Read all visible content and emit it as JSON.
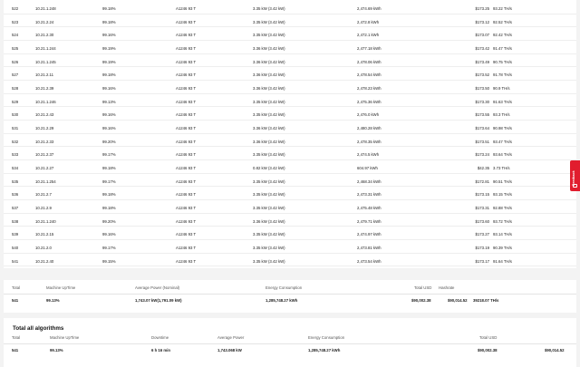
{
  "rows": [
    {
      "id": "522",
      "ip": "10.21.1.248",
      "uptime": "99.18%",
      "model": "A1246 93 T",
      "power": "3.35 kW (3.42 kW)",
      "energy": "2,474.69 kWh",
      "usd": "$173.25",
      "hash": "93.22 TH/s"
    },
    {
      "id": "523",
      "ip": "10.21.2.24",
      "uptime": "99.18%",
      "model": "A1246 93 T",
      "power": "3.35 kW (3.42 kW)",
      "energy": "2,472.8 kWh",
      "usd": "$173.12",
      "hash": "92.52 TH/s"
    },
    {
      "id": "524",
      "ip": "10.21.2.30",
      "uptime": "99.16%",
      "model": "A1246 93 T",
      "power": "3.35 kW (3.42 kW)",
      "energy": "2,472.1 kWh",
      "usd": "$173.07",
      "hash": "92.42 TH/s"
    },
    {
      "id": "525",
      "ip": "10.21.1.244",
      "uptime": "99.19%",
      "model": "A1246 93 T",
      "power": "3.36 kW (3.42 kW)",
      "energy": "2,477.18 kWh",
      "usd": "$173.42",
      "hash": "91.47 TH/s"
    },
    {
      "id": "526",
      "ip": "10.21.1.245",
      "uptime": "99.19%",
      "model": "A1246 93 T",
      "power": "3.36 kW (3.42 kW)",
      "energy": "2,478.06 kWh",
      "usd": "$173.49",
      "hash": "90.75 TH/s"
    },
    {
      "id": "527",
      "ip": "10.21.2.11",
      "uptime": "99.18%",
      "model": "A1246 93 T",
      "power": "3.36 kW (3.42 kW)",
      "energy": "2,478.54 kWh",
      "usd": "$173.52",
      "hash": "91.78 TH/s"
    },
    {
      "id": "528",
      "ip": "10.21.2.39",
      "uptime": "99.16%",
      "model": "A1246 93 T",
      "power": "3.36 kW (3.42 kW)",
      "energy": "2,478.23 kWh",
      "usd": "$173.50",
      "hash": "90.9 TH/s"
    },
    {
      "id": "529",
      "ip": "10.21.1.246",
      "uptime": "99.13%",
      "model": "A1246 93 T",
      "power": "3.35 kW (3.42 kW)",
      "energy": "2,475.36 kWh",
      "usd": "$173.30",
      "hash": "91.63 TH/s"
    },
    {
      "id": "530",
      "ip": "10.21.2.43",
      "uptime": "99.16%",
      "model": "A1246 93 T",
      "power": "3.35 kW (3.42 kW)",
      "energy": "2,476.0 kWh",
      "usd": "$173.55",
      "hash": "93.3 TH/s"
    },
    {
      "id": "531",
      "ip": "10.21.2.29",
      "uptime": "99.16%",
      "model": "A1246 93 T",
      "power": "3.36 kW (3.42 kW)",
      "energy": "2,480.28 kWh",
      "usd": "$173.64",
      "hash": "90.98 TH/s"
    },
    {
      "id": "532",
      "ip": "10.21.2.33",
      "uptime": "99.20%",
      "model": "A1246 93 T",
      "power": "3.36 kW (3.42 kW)",
      "energy": "2,478.35 kWh",
      "usd": "$173.51",
      "hash": "93.47 TH/s"
    },
    {
      "id": "533",
      "ip": "10.21.2.37",
      "uptime": "99.17%",
      "model": "A1246 93 T",
      "power": "3.35 kW (3.42 kW)",
      "energy": "2,474.5 kWh",
      "usd": "$173.24",
      "hash": "93.64 TH/s"
    },
    {
      "id": "534",
      "ip": "10.21.2.27",
      "uptime": "99.18%",
      "model": "A1246 93 T",
      "power": "0.82 kW (3.42 kW)",
      "energy": "604.97 kWh",
      "usd": "$42.35",
      "hash": "3.73 TH/s"
    },
    {
      "id": "535",
      "ip": "10.21.1.254",
      "uptime": "99.17%",
      "model": "A1246 93 T",
      "power": "3.35 kW (3.42 kW)",
      "energy": "2,468.34 kWh",
      "usd": "$172.81",
      "hash": "90.51 TH/s"
    },
    {
      "id": "536",
      "ip": "10.21.2.7",
      "uptime": "99.18%",
      "model": "A1246 93 T",
      "power": "3.35 kW (3.42 kW)",
      "energy": "2,473.31 kWh",
      "usd": "$173.15",
      "hash": "93.15 TH/s"
    },
    {
      "id": "537",
      "ip": "10.21.2.9",
      "uptime": "99.18%",
      "model": "A1246 93 T",
      "power": "3.35 kW (3.42 kW)",
      "energy": "2,475.48 kWh",
      "usd": "$173.31",
      "hash": "92.88 TH/s"
    },
    {
      "id": "538",
      "ip": "10.21.1.240",
      "uptime": "99.20%",
      "model": "A1246 93 T",
      "power": "3.36 kW (3.42 kW)",
      "energy": "2,479.71 kWh",
      "usd": "$173.60",
      "hash": "93.72 TH/s"
    },
    {
      "id": "539",
      "ip": "10.21.2.15",
      "uptime": "99.16%",
      "model": "A1246 93 T",
      "power": "3.35 kW (3.42 kW)",
      "energy": "2,474.97 kWh",
      "usd": "$173.27",
      "hash": "93.14 TH/s"
    },
    {
      "id": "540",
      "ip": "10.21.2.0",
      "uptime": "99.17%",
      "model": "A1246 93 T",
      "power": "3.35 kW (3.42 kW)",
      "energy": "2,473.81 kWh",
      "usd": "$173.19",
      "hash": "90.39 TH/s"
    },
    {
      "id": "541",
      "ip": "10.21.2.40",
      "uptime": "99.15%",
      "model": "A1246 93 T",
      "power": "3.35 kW (3.42 kW)",
      "energy": "2,473.54 kWh",
      "usd": "$173.17",
      "hash": "91.64 TH/s"
    }
  ],
  "summary": {
    "headers": {
      "total": "Total",
      "uptime": "Machine UpTime",
      "avg_power": "Average Power (Nominal)",
      "energy": "Energy Consumption",
      "usd": "Total USD",
      "hashrate": "Hashrate"
    },
    "values": {
      "total": "541",
      "uptime": "99.13%",
      "avg_power": "1,743.07 kW(1,791.09 kW)",
      "energy": "1,285,748.27 kWh",
      "usd": "$90,002.38",
      "hashrate": "39218.07 TH/s"
    }
  },
  "total_all": {
    "title": "Total all algorithms",
    "headers": {
      "total": "Total",
      "uptime": "Machine UpTime",
      "downtime": "Downtime",
      "avg_power": "Average Power",
      "energy": "Energy Consumption",
      "usd": "Total USD"
    },
    "values": {
      "total": "541",
      "uptime": "99.13%",
      "downtime": "6 h 16 min",
      "avg_power": "1,743.068 kW",
      "energy": "1,285,748.27 kWh",
      "usd": "$90,002.38",
      "usd_right": "$90,014.52"
    }
  },
  "summary_extra_usd": "$90,014.52",
  "feedback": {
    "label": "Feedback",
    "color": "#e11d2e"
  }
}
